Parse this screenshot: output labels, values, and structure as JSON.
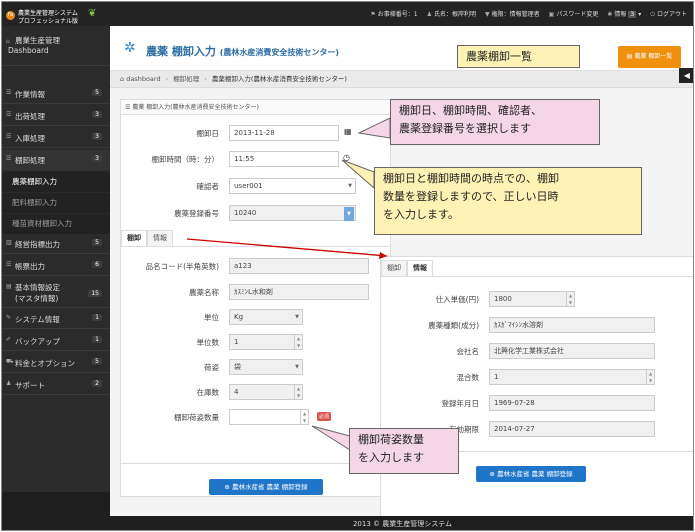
{
  "app": {
    "title_line1": "農業生産管理システム",
    "title_line2": "プロフェッショナル版",
    "badge": "Fa"
  },
  "topnav": {
    "office_no_label": "お事様番号：",
    "office_no": "1",
    "user_label": "氏名：",
    "user": "根岸利明",
    "role_label": "権限：",
    "role": "情報管理者",
    "password": "パスワード変更",
    "info_label": "情報",
    "info_count": "3",
    "logout": "ログアウト"
  },
  "sidebar": {
    "items": [
      {
        "label": "農業生産管理",
        "label2": "Dashboard",
        "count": ""
      },
      {
        "label": "作業情報",
        "count": "5"
      },
      {
        "label": "出荷処理",
        "count": "3"
      },
      {
        "label": "入庫処理",
        "count": "3"
      },
      {
        "label": "棚卸処理",
        "count": "3"
      },
      {
        "label": "経営指標出力",
        "count": "5"
      },
      {
        "label": "帳票出力",
        "count": "6"
      },
      {
        "label": "基本情報設定",
        "label2": "(マスタ情報)",
        "count": "15"
      },
      {
        "label": "システム情報",
        "count": "1"
      },
      {
        "label": "バックアップ",
        "count": "1"
      },
      {
        "label": "料金とオプション",
        "count": "5"
      },
      {
        "label": "サポート",
        "count": "2"
      }
    ],
    "subitems": [
      "農薬棚卸入力",
      "肥料棚卸入力",
      "種苗資材棚卸入力"
    ]
  },
  "page": {
    "title": "農薬 棚卸入力",
    "subtitle": "(農林水産消費安全技術センター)",
    "list_button": "農薬 棚卸一覧"
  },
  "breadcrumb": {
    "home": "dashboard",
    "middle": "棚卸処理",
    "current": "農薬棚卸入力(農林水産消費安全技術センター)"
  },
  "form": {
    "panel_title": "農薬 棚卸入力(農林水産消費安全技術センター)",
    "date_label": "棚卸日",
    "date_value": "2013-11-28",
    "time_label": "棚卸時間（時：分）",
    "time_value": "11:55",
    "confirmer_label": "確認者",
    "confirmer_value": "user001",
    "reg_label": "農薬登録番号",
    "reg_value": "10240"
  },
  "tabs1": {
    "a": "棚卸",
    "b": "情報"
  },
  "detail1": {
    "name_code_label": "品名コード(半角英数)",
    "name_code_value": "a123",
    "pesticide_name_label": "農薬名称",
    "pesticide_name_value": "ｶｽﾐﾝL水和剤",
    "unit_label": "単位",
    "unit_value": "Kg",
    "unit_qty_label": "単位数",
    "unit_qty_value": "1",
    "packing_label": "荷姿",
    "packing_value": "袋",
    "stock_label": "在庫数",
    "stock_value": "4",
    "inv_qty_label": "棚卸荷姿数量",
    "inv_qty_value": "",
    "required": "必須",
    "submit": "農林水産省 農薬 棚卸登録"
  },
  "tabs2": {
    "a": "棚卸",
    "b": "情報"
  },
  "detail2": {
    "unit_price_label": "仕入単価(円)",
    "unit_price_value": "1800",
    "type_label": "農薬種類(成分)",
    "type_value": "ｶｽｶﾞﾏｲｼﾝ水溶剤",
    "company_label": "会社名",
    "company_value": "北興化学工業株式会社",
    "mix_label": "混合数",
    "mix_value": "1",
    "regdate_label": "登録年月日",
    "regdate_value": "1969-07-28",
    "expiry_label": "有効期限",
    "expiry_value": "2014-07-27",
    "submit": "農林水産省 農薬 棚卸登録"
  },
  "footer": "2013 © 農業生産管理システム",
  "callouts": {
    "list": "農薬棚卸一覧",
    "select": "棚卸日、棚卸時間、確認者、\n農薬登録番号を選択します",
    "register": "棚卸日と棚卸時間の時点での、棚卸\n数量を登録しますので、正しい日時\nを入力します。",
    "quantity": "棚卸荷姿数量\nを入力します"
  }
}
